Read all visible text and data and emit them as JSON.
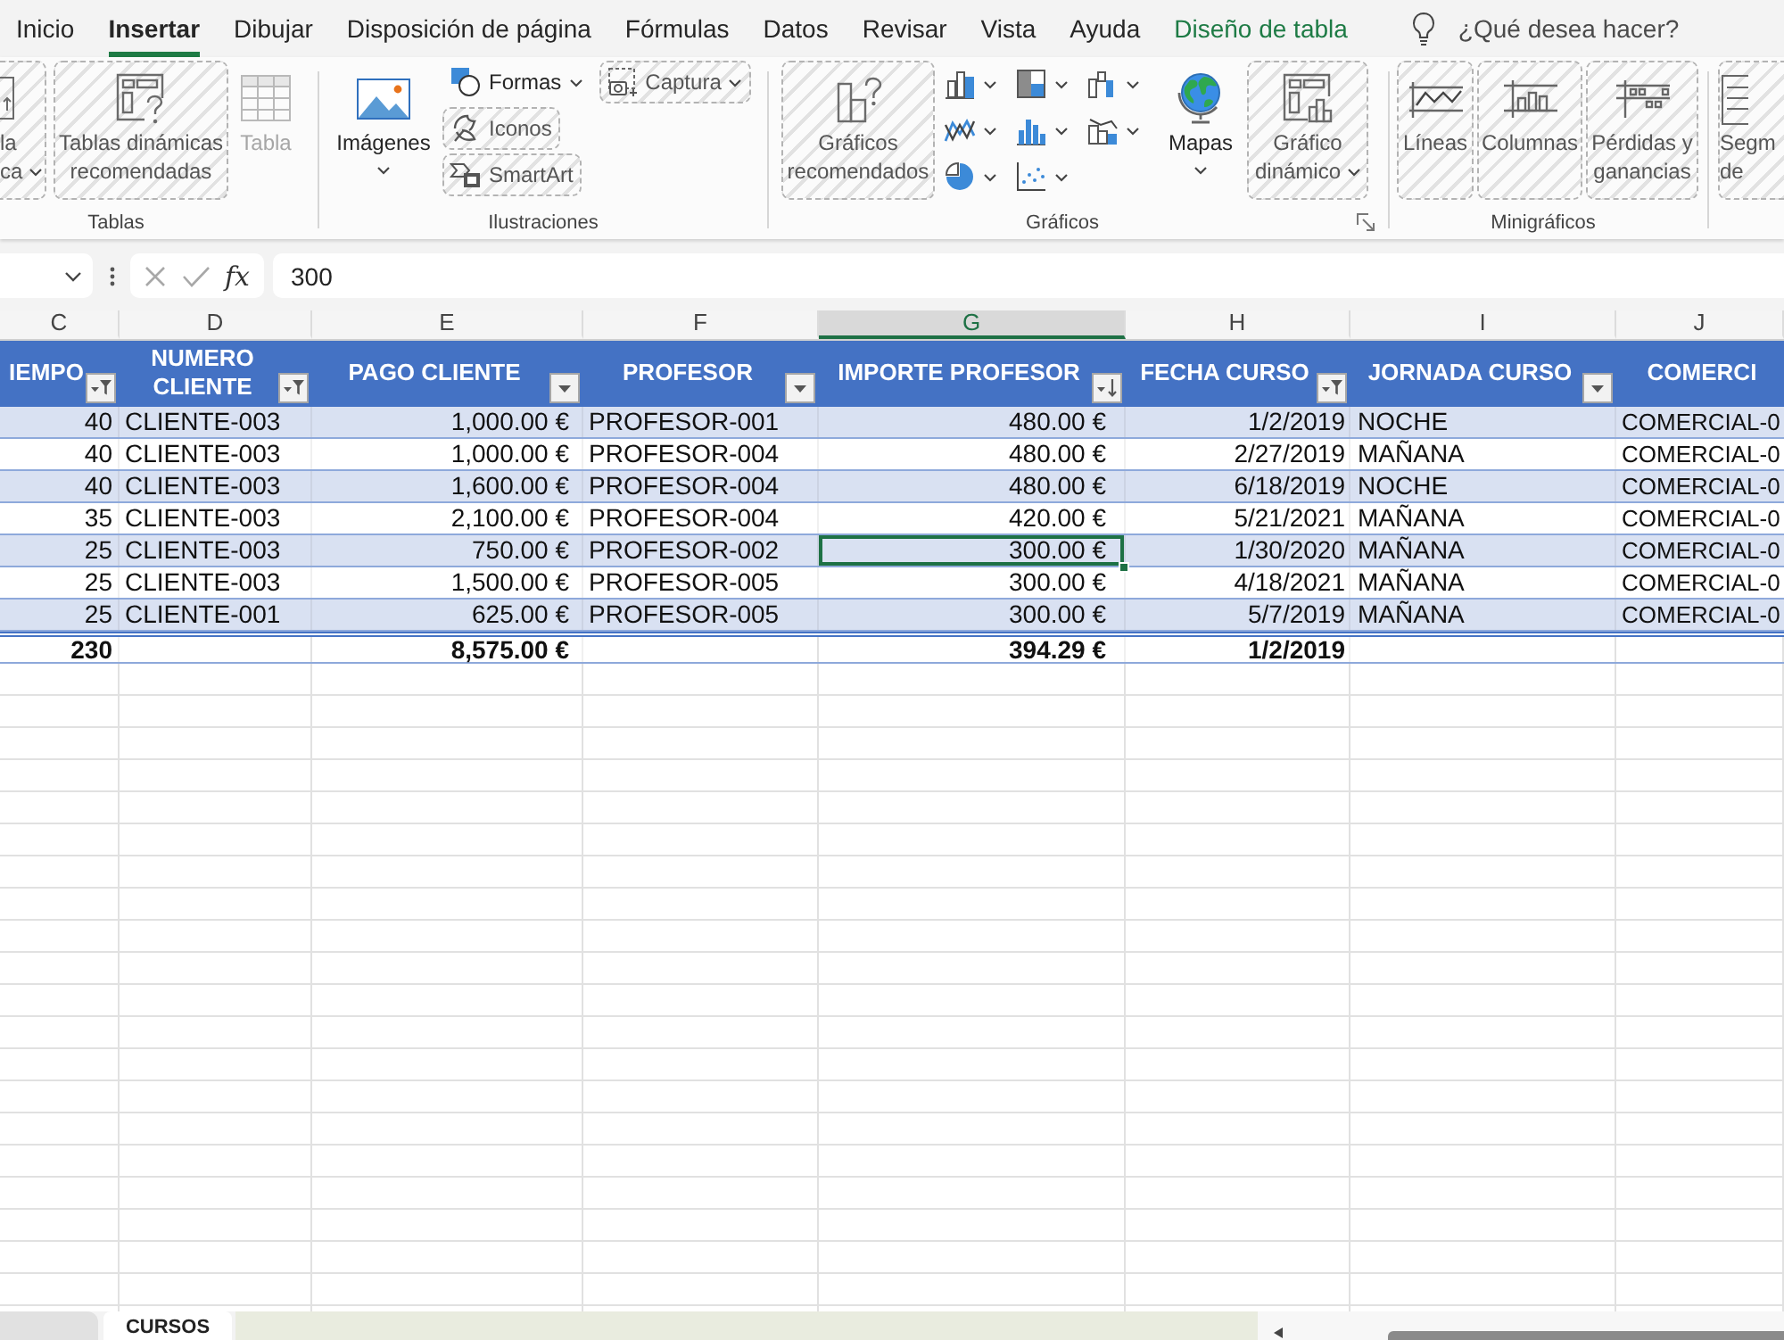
{
  "tabs": [
    {
      "label": "Inicio",
      "selected": false,
      "contextual": false
    },
    {
      "label": "Insertar",
      "selected": true,
      "contextual": false
    },
    {
      "label": "Dibujar",
      "selected": false,
      "contextual": false
    },
    {
      "label": "Disposición de página",
      "selected": false,
      "contextual": false
    },
    {
      "label": "Fórmulas",
      "selected": false,
      "contextual": false
    },
    {
      "label": "Datos",
      "selected": false,
      "contextual": false
    },
    {
      "label": "Revisar",
      "selected": false,
      "contextual": false
    },
    {
      "label": "Vista",
      "selected": false,
      "contextual": false
    },
    {
      "label": "Ayuda",
      "selected": false,
      "contextual": false
    },
    {
      "label": "Diseño de tabla",
      "selected": false,
      "contextual": true
    }
  ],
  "tell_me": {
    "placeholder": "¿Qué desea hacer?"
  },
  "ribbon": {
    "groups": [
      {
        "label": "Tablas",
        "items": [
          {
            "kind": "large",
            "label": "la ca",
            "dropdown": true,
            "hatched": true,
            "disabled": false
          },
          {
            "kind": "large",
            "label": "Tablas dinámicas recomendadas",
            "dropdown": false,
            "hatched": true,
            "disabled": false
          },
          {
            "kind": "large",
            "label": "Tabla",
            "dropdown": false,
            "hatched": false,
            "disabled": true
          }
        ]
      },
      {
        "label": "Ilustraciones",
        "items": [
          {
            "kind": "large",
            "label": "Imágenes",
            "dropdown": true,
            "hatched": false,
            "disabled": false
          },
          {
            "kind": "small",
            "label": "Formas",
            "dropdown": true,
            "hatched": false,
            "disabled": false
          },
          {
            "kind": "small",
            "label": "Iconos",
            "dropdown": false,
            "hatched": true,
            "disabled": false
          },
          {
            "kind": "small",
            "label": "SmartArt",
            "dropdown": false,
            "hatched": true,
            "disabled": false
          },
          {
            "kind": "small",
            "label": "Captura",
            "dropdown": true,
            "hatched": true,
            "disabled": false
          }
        ]
      },
      {
        "label": "Gráficos",
        "items": [
          {
            "kind": "large",
            "label": "Gráficos recomendados",
            "dropdown": false,
            "hatched": true,
            "disabled": false
          },
          {
            "kind": "large",
            "label": "Mapas",
            "dropdown": true,
            "hatched": false,
            "disabled": false
          },
          {
            "kind": "large",
            "label": "Gráfico dinámico",
            "dropdown": true,
            "hatched": true,
            "disabled": false
          }
        ]
      },
      {
        "label": "Minigráficos",
        "items": [
          {
            "kind": "large",
            "label": "Líneas",
            "dropdown": false,
            "hatched": true,
            "disabled": false
          },
          {
            "kind": "large",
            "label": "Columnas",
            "dropdown": false,
            "hatched": true,
            "disabled": false
          },
          {
            "kind": "large",
            "label": "Pérdidas y ganancias",
            "dropdown": false,
            "hatched": true,
            "disabled": false
          }
        ]
      },
      {
        "items": [
          {
            "kind": "large",
            "label": "Segm de",
            "dropdown": false,
            "hatched": true,
            "disabled": false
          }
        ]
      }
    ]
  },
  "formula_bar": {
    "function_label": "fx",
    "value": "300"
  },
  "column_headers": [
    {
      "letter": "C",
      "selected": false
    },
    {
      "letter": "D",
      "selected": false
    },
    {
      "letter": "E",
      "selected": false
    },
    {
      "letter": "F",
      "selected": false
    },
    {
      "letter": "G",
      "selected": true
    },
    {
      "letter": "H",
      "selected": false
    },
    {
      "letter": "I",
      "selected": false
    },
    {
      "letter": "J",
      "selected": false
    }
  ],
  "table": {
    "columns": [
      {
        "label": "IEMPO",
        "filter_button": true,
        "filtered": true,
        "sorted": false
      },
      {
        "label": "NUMERO CLIENTE",
        "filter_button": true,
        "filtered": true,
        "sorted": false
      },
      {
        "label": "PAGO CLIENTE",
        "filter_button": true,
        "filtered": false,
        "sorted": false
      },
      {
        "label": "PROFESOR",
        "filter_button": true,
        "filtered": false,
        "sorted": false
      },
      {
        "label": "IMPORTE PROFESOR",
        "filter_button": true,
        "filtered": false,
        "sorted": true
      },
      {
        "label": "FECHA CURSO",
        "filter_button": true,
        "filtered": true,
        "sorted": false
      },
      {
        "label": "JORNADA CURSO",
        "filter_button": true,
        "filtered": false,
        "sorted": false
      },
      {
        "label": "COMERCI",
        "filter_button": false
      }
    ],
    "rows": [
      {
        "kind": "data",
        "cells": [
          {
            "value": "40",
            "selected": false
          },
          {
            "value": "CLIENTE-003",
            "selected": false
          },
          {
            "value": "1,000.00 €",
            "selected": false
          },
          {
            "value": "PROFESOR-001",
            "selected": false
          },
          {
            "value": "480.00 €",
            "selected": false
          },
          {
            "value": "1/2/2019",
            "selected": false
          },
          {
            "value": "NOCHE",
            "selected": false
          },
          {
            "value": "COMERCIAL-0",
            "selected": false
          }
        ]
      },
      {
        "kind": "data",
        "cells": [
          {
            "value": "40",
            "selected": false
          },
          {
            "value": "CLIENTE-003",
            "selected": false
          },
          {
            "value": "1,000.00 €",
            "selected": false
          },
          {
            "value": "PROFESOR-004",
            "selected": false
          },
          {
            "value": "480.00 €",
            "selected": false
          },
          {
            "value": "2/27/2019",
            "selected": false
          },
          {
            "value": "MAÑANA",
            "selected": false
          },
          {
            "value": "COMERCIAL-0",
            "selected": false
          }
        ]
      },
      {
        "kind": "data",
        "cells": [
          {
            "value": "40",
            "selected": false
          },
          {
            "value": "CLIENTE-003",
            "selected": false
          },
          {
            "value": "1,600.00 €",
            "selected": false
          },
          {
            "value": "PROFESOR-004",
            "selected": false
          },
          {
            "value": "480.00 €",
            "selected": false
          },
          {
            "value": "6/18/2019",
            "selected": false
          },
          {
            "value": "NOCHE",
            "selected": false
          },
          {
            "value": "COMERCIAL-0",
            "selected": false
          }
        ]
      },
      {
        "kind": "data",
        "cells": [
          {
            "value": "35",
            "selected": false
          },
          {
            "value": "CLIENTE-003",
            "selected": false
          },
          {
            "value": "2,100.00 €",
            "selected": false
          },
          {
            "value": "PROFESOR-004",
            "selected": false
          },
          {
            "value": "420.00 €",
            "selected": false
          },
          {
            "value": "5/21/2021",
            "selected": false
          },
          {
            "value": "MAÑANA",
            "selected": false
          },
          {
            "value": "COMERCIAL-0",
            "selected": false
          }
        ]
      },
      {
        "kind": "data",
        "cells": [
          {
            "value": "25",
            "selected": false
          },
          {
            "value": "CLIENTE-003",
            "selected": false
          },
          {
            "value": "750.00 €",
            "selected": false
          },
          {
            "value": "PROFESOR-002",
            "selected": false
          },
          {
            "value": "300.00 €",
            "selected": true
          },
          {
            "value": "1/30/2020",
            "selected": false
          },
          {
            "value": "MAÑANA",
            "selected": false
          },
          {
            "value": "COMERCIAL-0",
            "selected": false
          }
        ]
      },
      {
        "kind": "data",
        "cells": [
          {
            "value": "25",
            "selected": false
          },
          {
            "value": "CLIENTE-003",
            "selected": false
          },
          {
            "value": "1,500.00 €",
            "selected": false
          },
          {
            "value": "PROFESOR-005",
            "selected": false
          },
          {
            "value": "300.00 €",
            "selected": false
          },
          {
            "value": "4/18/2021",
            "selected": false
          },
          {
            "value": "MAÑANA",
            "selected": false
          },
          {
            "value": "COMERCIAL-0",
            "selected": false
          }
        ]
      },
      {
        "kind": "data",
        "cells": [
          {
            "value": "25",
            "selected": false
          },
          {
            "value": "CLIENTE-001",
            "selected": false
          },
          {
            "value": "625.00 €",
            "selected": false
          },
          {
            "value": "PROFESOR-005",
            "selected": false
          },
          {
            "value": "300.00 €",
            "selected": false
          },
          {
            "value": "5/7/2019",
            "selected": false
          },
          {
            "value": "MAÑANA",
            "selected": false
          },
          {
            "value": "COMERCIAL-0",
            "selected": false
          }
        ]
      },
      {
        "kind": "total",
        "cells": [
          {
            "value": "230",
            "selected": false
          },
          {
            "selected": false
          },
          {
            "value": "8,575.00 €",
            "selected": false
          },
          {
            "selected": false
          },
          {
            "value": "394.29 €",
            "selected": false
          },
          {
            "value": "1/2/2019",
            "selected": false
          },
          {
            "selected": false
          },
          {
            "selected": false
          }
        ]
      }
    ]
  },
  "sheet_tabs": [
    {
      "label": "CURSOS",
      "selected": true
    }
  ]
}
